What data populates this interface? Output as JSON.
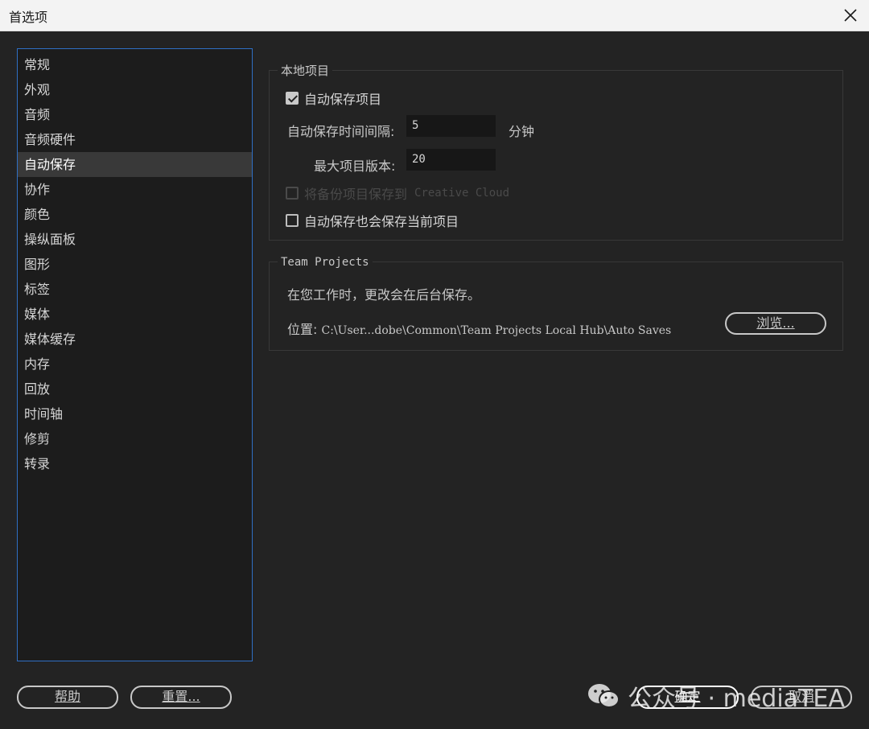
{
  "window": {
    "title": "首选项"
  },
  "sidebar": {
    "items": [
      {
        "label": "常规"
      },
      {
        "label": "外观"
      },
      {
        "label": "音频"
      },
      {
        "label": "音频硬件"
      },
      {
        "label": "自动保存",
        "selected": true
      },
      {
        "label": "协作"
      },
      {
        "label": "颜色"
      },
      {
        "label": "操纵面板"
      },
      {
        "label": "图形"
      },
      {
        "label": "标签"
      },
      {
        "label": "媒体"
      },
      {
        "label": "媒体缓存"
      },
      {
        "label": "内存"
      },
      {
        "label": "回放"
      },
      {
        "label": "时间轴"
      },
      {
        "label": "修剪"
      },
      {
        "label": "转录"
      }
    ]
  },
  "local_project": {
    "title": "本地项目",
    "auto_save_checkbox": {
      "label": "自动保存项目",
      "checked": true
    },
    "interval": {
      "label": "自动保存时间间隔:",
      "value": "5",
      "unit": "分钟"
    },
    "max_versions": {
      "label": "最大项目版本:",
      "value": "20"
    },
    "cloud_backup_checkbox": {
      "label_prefix": "将备份项目保存到",
      "label_suffix": "Creative Cloud",
      "checked": false,
      "enabled": false
    },
    "save_current_checkbox": {
      "label": "自动保存也会保存当前项目",
      "checked": false
    }
  },
  "team_projects": {
    "title": "Team Projects",
    "description": "在您工作时，更改会在后台保存。",
    "location_label": "位置:",
    "location_path": "C:\\User...dobe\\Common\\Team Projects Local Hub\\Auto Saves",
    "browse_label": "浏览..."
  },
  "footer": {
    "help_label": "帮助",
    "reset_label": "重置...",
    "ok_label": "确定",
    "cancel_label": "取消"
  },
  "watermark": {
    "text": "公众号 · mediaTEA"
  }
}
